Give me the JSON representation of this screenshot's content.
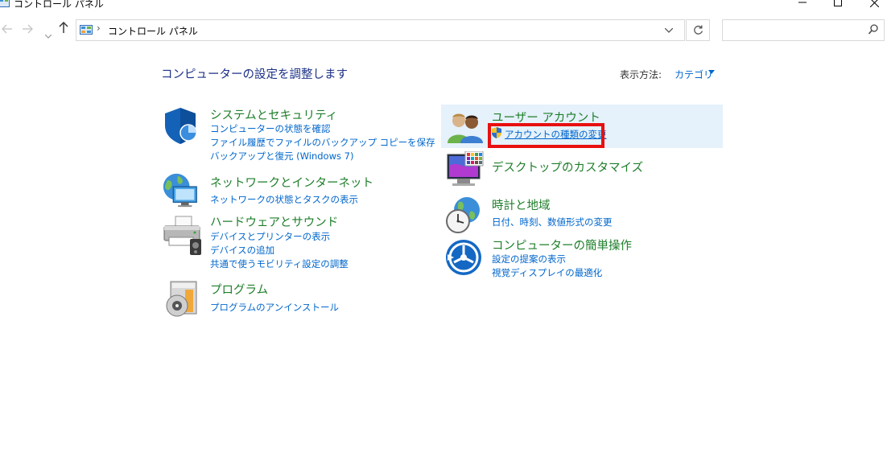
{
  "window": {
    "title": "コントロール パネル"
  },
  "nav": {
    "back_icon": "back-arrow-icon",
    "forward_icon": "forward-arrow-icon",
    "recent_icon": "chevron-down-icon",
    "up_icon": "up-arrow-icon"
  },
  "address": {
    "location": "コントロール パネル",
    "separator": "›"
  },
  "search": {
    "placeholder": ""
  },
  "header": {
    "title": "コンピューターの設定を調整します",
    "view_label": "表示方法:",
    "view_value": "カテゴリ"
  },
  "categories": [
    {
      "title": "システムとセキュリティ",
      "icon": "shield-icon",
      "links": [
        "コンピューターの状態を確認",
        "ファイル履歴でファイルのバックアップ コピーを保存",
        "バックアップと復元 (Windows 7)"
      ]
    },
    {
      "title": "ネットワークとインターネット",
      "icon": "network-globe-icon",
      "links": [
        "ネットワークの状態とタスクの表示"
      ]
    },
    {
      "title": "ハードウェアとサウンド",
      "icon": "printer-icon",
      "links": [
        "デバイスとプリンターの表示",
        "デバイスの追加",
        "共通で使うモビリティ設定の調整"
      ]
    },
    {
      "title": "プログラム",
      "icon": "programs-disc-icon",
      "links": [
        "プログラムのアンインストール"
      ]
    },
    {
      "title": "ユーザー アカウント",
      "icon": "user-accounts-icon",
      "links": [
        "アカウントの種類の変更"
      ]
    },
    {
      "title": "デスクトップのカスタマイズ",
      "icon": "monitor-icon",
      "links": []
    },
    {
      "title": "時計と地域",
      "icon": "clock-globe-icon",
      "links": [
        "日付、時刻、数値形式の変更"
      ]
    },
    {
      "title": "コンピューターの簡単操作",
      "icon": "ease-of-access-icon",
      "links": [
        "設定の提案の表示",
        "視覚ディスプレイの最適化"
      ]
    }
  ],
  "colors": {
    "title_blue": "#1e3287",
    "category_green": "#1e7e2a",
    "link_blue": "#0066cc",
    "highlight": "#e5f1fb",
    "annotation_red": "#e81010"
  }
}
